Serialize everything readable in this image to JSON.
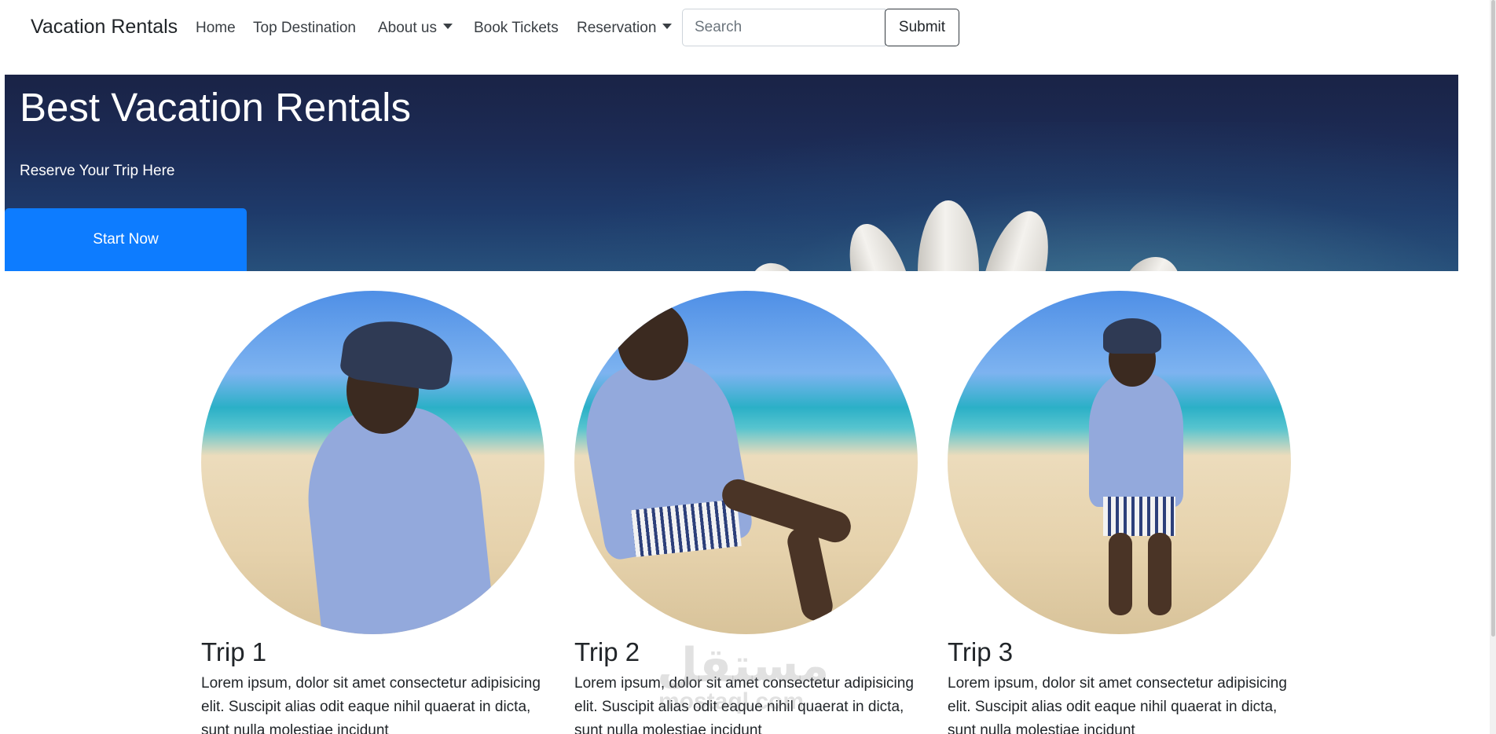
{
  "navbar": {
    "brand": "Vacation Rentals",
    "items": [
      {
        "label": "Home"
      },
      {
        "label": "Top Destination"
      },
      {
        "label": "About us"
      },
      {
        "label": "Book Tickets"
      },
      {
        "label": "Reservation"
      }
    ],
    "search_placeholder": "Search",
    "submit_label": "Submit"
  },
  "hero": {
    "title": "Best Vacation Rentals",
    "subtitle": "Reserve Your Trip Here",
    "button_label": "Start Now"
  },
  "trips": [
    {
      "title": "Trip 1",
      "text": "Lorem ipsum, dolor sit amet consectetur adipisicing elit. Suscipit alias odit eaque nihil quaerat in dicta, sunt nulla molestiae incidunt"
    },
    {
      "title": "Trip 2",
      "text": "Lorem ipsum, dolor sit amet consectetur adipisicing elit. Suscipit alias odit eaque nihil quaerat in dicta, sunt nulla molestiae incidunt"
    },
    {
      "title": "Trip 3",
      "text": "Lorem ipsum, dolor sit amet consectetur adipisicing elit. Suscipit alias odit eaque nihil quaerat in dicta, sunt nulla molestiae incidunt"
    }
  ],
  "watermark": {
    "text": "مستقل",
    "sub": "mostaql.com"
  },
  "colors": {
    "primary_button": "#0d7cff",
    "hero_background": "#1c2b55"
  }
}
